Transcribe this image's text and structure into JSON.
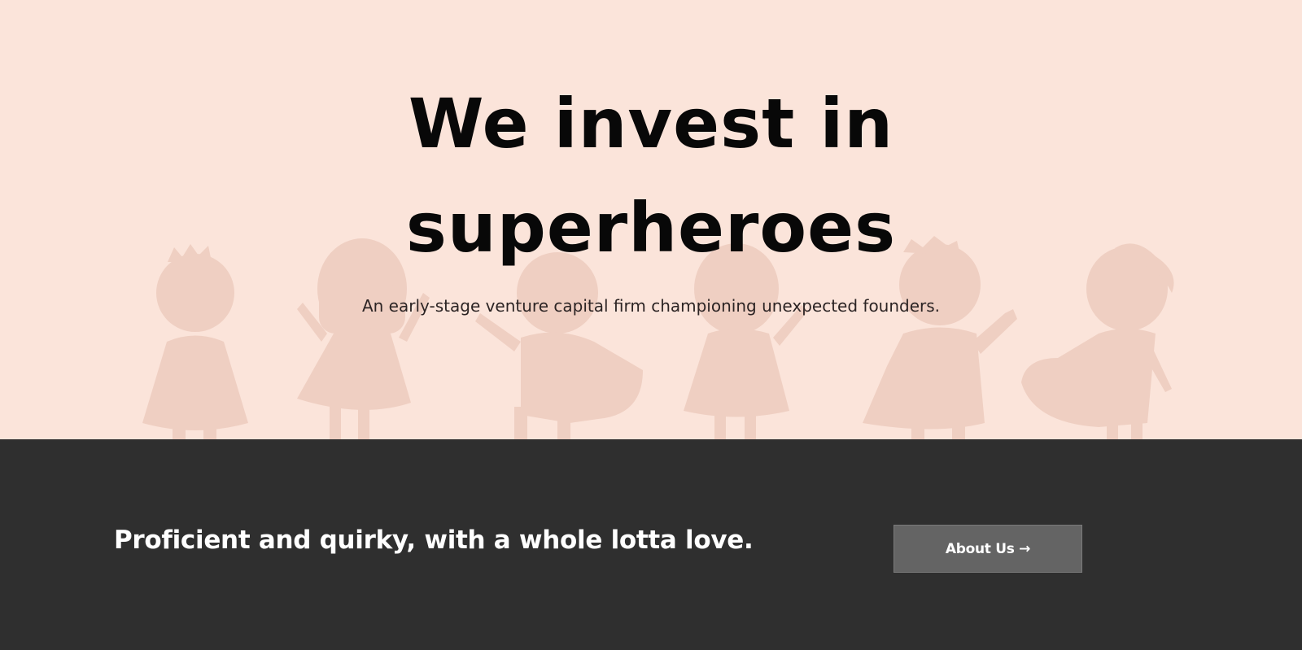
{
  "hero": {
    "title_line1": "We invest in",
    "title_line2": "superheroes",
    "subtitle": "An early-stage venture capital firm championing unexpected founders.",
    "background_color": "#fbe4da",
    "illustration": "superhero-kids-silhouettes-illustration"
  },
  "band": {
    "tagline": "Proficient and quirky, with a whole lotta love.",
    "background_color": "#2f2f2f",
    "cta_label": "About Us →"
  }
}
